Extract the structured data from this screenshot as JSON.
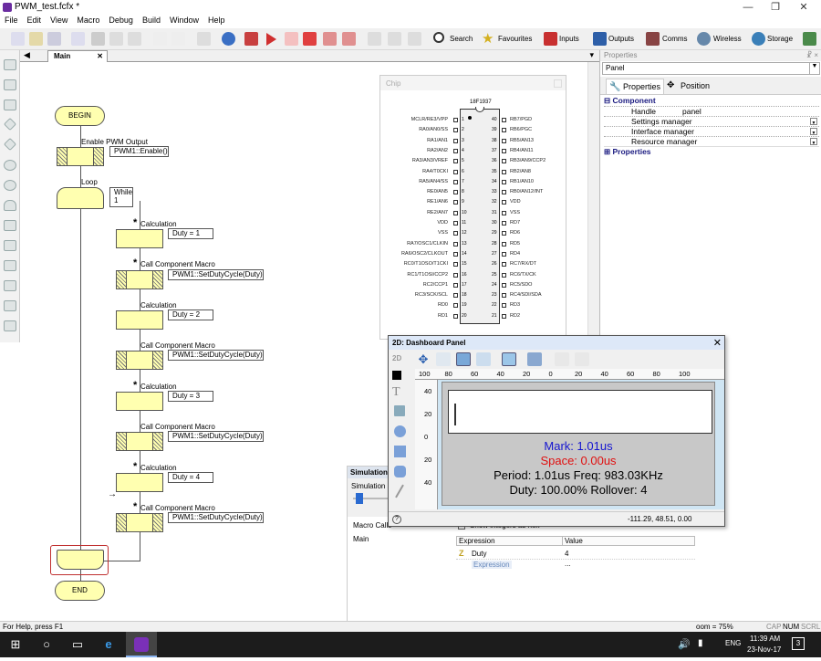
{
  "window": {
    "title": "PWM_test.fcfx *"
  },
  "menu": [
    "File",
    "Edit",
    "View",
    "Macro",
    "Debug",
    "Build",
    "Window",
    "Help"
  ],
  "toolbar": {
    "search": "Search",
    "favourites": "Favourites",
    "inputs": "Inputs",
    "outputs": "Outputs",
    "comms": "Comms",
    "wireless": "Wireless",
    "storage": "Storage"
  },
  "tabs": {
    "main": "Main"
  },
  "flowchart": {
    "begin": "BEGIN",
    "end": "END",
    "enable_label": "Enable PWM Output",
    "enable_call": "PWM1::Enable()",
    "loop_label": "Loop",
    "while_label": "While",
    "while_cond": "1",
    "calc_label": "Calculation",
    "macro_label": "Call Component Macro",
    "duty1": "Duty = 1",
    "duty2": "Duty = 2",
    "duty3": "Duty = 3",
    "duty4": "Duty = 4",
    "setduty": "PWM1::SetDutyCycle(Duty)",
    "star": "*",
    "arrow": "→"
  },
  "chip": {
    "title": "Chip",
    "part": "18F1937",
    "left_pins": [
      "MCLR/RE3/VPP",
      "RA0/AN0/SS",
      "RA1/AN1",
      "RA2/AN2",
      "RA3/AN3/VREF",
      "RA4/T0CKI",
      "RA5/AN4/SS",
      "RE0/AN5",
      "RE1/AN6",
      "RE2/AN7",
      "VDD",
      "VSS",
      "RA7/OSC1/CLKIN",
      "RA6/OSC2/CLKOUT",
      "RC0/T1OSO/T1CKI",
      "RC1/T1OSI/CCP2",
      "RC2/CCP1",
      "RC3/SCK/SCL",
      "RD0",
      "RD1"
    ],
    "right_pins": [
      "RB7/PGD",
      "RB6/PGC",
      "RB5/AN13",
      "RB4/AN11",
      "RB3/AN9/CCP2",
      "RB2/AN8",
      "RB1/AN10",
      "RB0/AN12/INT",
      "VDD",
      "VSS",
      "RD7",
      "RD6",
      "RD5",
      "RD4",
      "RC7/RX/DT",
      "RC6/TX/CK",
      "RC5/SDO",
      "RC4/SDI/SDA",
      "RD3",
      "RD2"
    ]
  },
  "properties": {
    "title": "Properties",
    "pin": "☧ ×",
    "combo": "Panel",
    "tab_props": "Properties",
    "tab_pos": "Position",
    "component": "Component",
    "handle_key": "Handle",
    "handle_val": "panel",
    "settings": "Settings manager",
    "interface": "Interface manager",
    "resource": "Resource manager",
    "properties": "Properties"
  },
  "simulation": {
    "title": "Simulation",
    "speed": "Simulation sp",
    "macro_calls": "Macro Calls",
    "main": "Main"
  },
  "watch": {
    "show_hex": "Show integers as hex",
    "col_expr": "Expression",
    "col_val": "Value",
    "var_name": "Duty",
    "var_val": "4",
    "expr_placeholder": "Expression",
    "expr_val": "..."
  },
  "dashboard": {
    "title": "2D: Dashboard Panel",
    "mode": "2D",
    "ruler_h": [
      "100",
      "80",
      "60",
      "40",
      "20",
      "0",
      "20",
      "40",
      "60",
      "80",
      "100"
    ],
    "ruler_v": [
      "40",
      "20",
      "0",
      "20",
      "40"
    ],
    "mark": "Mark: 1.01us",
    "space": "Space: 0.00us",
    "period": "Period: 1.01us   Freq: 983.03KHz",
    "duty": "Duty: 100.00%   Rollover: 4",
    "coords": "-111.29, 48.51, 0.00",
    "mark_color": "#1515d0",
    "space_color": "#e01010"
  },
  "status": {
    "help": "For Help, press F1",
    "zoom": "oom = 75%",
    "cap": "CAP",
    "num": "NUM",
    "scrl": "SCRL"
  },
  "taskbar": {
    "lang": "ENG",
    "time": "11:39 AM",
    "date": "23-Nov-17",
    "notif": "3"
  }
}
